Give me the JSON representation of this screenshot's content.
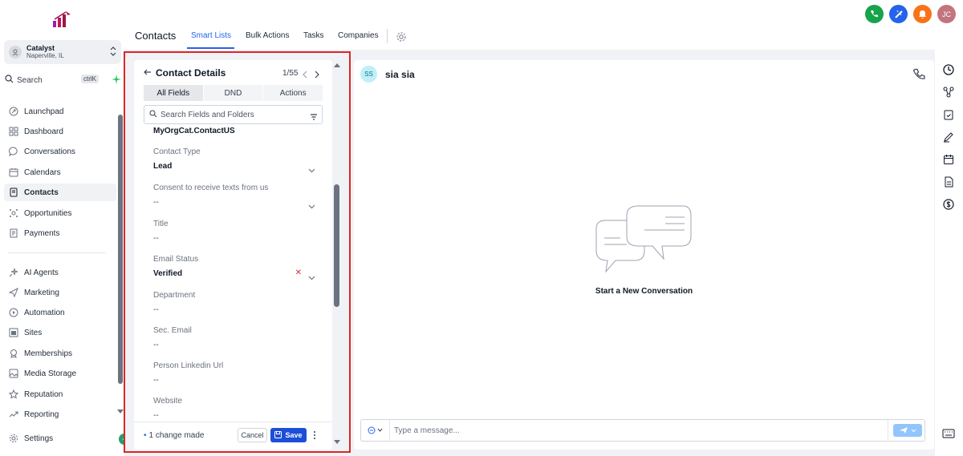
{
  "sidebar": {
    "account": {
      "name": "Catalyst",
      "location": "Naperville, IL"
    },
    "search": {
      "label": "Search",
      "shortcut": "ctrlK"
    },
    "items": [
      {
        "label": "Launchpad",
        "icon": "rocket-icon"
      },
      {
        "label": "Dashboard",
        "icon": "grid-icon"
      },
      {
        "label": "Conversations",
        "icon": "chat-icon"
      },
      {
        "label": "Calendars",
        "icon": "calendar-icon"
      },
      {
        "label": "Contacts",
        "icon": "contacts-icon",
        "active": true
      },
      {
        "label": "Opportunities",
        "icon": "opportunities-icon"
      },
      {
        "label": "Payments",
        "icon": "payments-icon"
      },
      {
        "label": "AI Agents",
        "icon": "ai-sparkle-icon"
      },
      {
        "label": "Marketing",
        "icon": "send-icon"
      },
      {
        "label": "Automation",
        "icon": "automation-icon"
      },
      {
        "label": "Sites",
        "icon": "sites-icon"
      },
      {
        "label": "Memberships",
        "icon": "memberships-icon"
      },
      {
        "label": "Media Storage",
        "icon": "image-icon"
      },
      {
        "label": "Reputation",
        "icon": "star-icon"
      },
      {
        "label": "Reporting",
        "icon": "trend-icon"
      },
      {
        "label": "Settings",
        "icon": "gear-icon"
      }
    ]
  },
  "topnav": {
    "title": "Contacts",
    "tabs": [
      {
        "label": "Smart Lists",
        "active": true
      },
      {
        "label": "Bulk Actions"
      },
      {
        "label": "Tasks"
      },
      {
        "label": "Companies"
      }
    ]
  },
  "topicons": {
    "user_initials": "JC",
    "colors": {
      "phone": "#16a34a",
      "ai": "#2563eb",
      "bell": "#f97316",
      "avatar": "#c2747f"
    }
  },
  "details": {
    "title": "Contact Details",
    "counter": "1/55",
    "tabs": [
      "All Fields",
      "DND",
      "Actions"
    ],
    "search_placeholder": "Search Fields and Folders",
    "top_value": "MyOrgCat.ContactUS",
    "fields": [
      {
        "label": "Contact Type",
        "value": "Lead"
      },
      {
        "label": "Consent to receive texts from us",
        "value": "--"
      },
      {
        "label": "Title",
        "value": "--"
      },
      {
        "label": "Email Status",
        "value": "Verified"
      },
      {
        "label": "Department",
        "value": "--"
      },
      {
        "label": "Sec. Email",
        "value": "--"
      },
      {
        "label": "Person Linkedin Url",
        "value": "--"
      },
      {
        "label": "Website",
        "value": "--"
      }
    ],
    "footer": {
      "changes": "1 change made",
      "cancel": "Cancel",
      "save": "Save"
    }
  },
  "conversation": {
    "initials": "SS",
    "contact_name": "sia sia",
    "empty_state": "Start a New Conversation",
    "composer_placeholder": "Type a message..."
  },
  "colors": {
    "accent": "#2563eb",
    "highlight_border": "#dc2626"
  }
}
